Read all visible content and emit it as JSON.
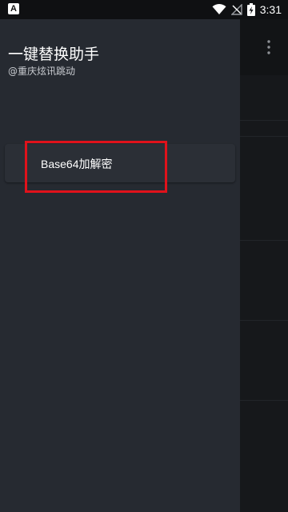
{
  "status_bar": {
    "time": "3:31",
    "app_icon": "A",
    "icons": [
      "wifi-icon",
      "signal-off-icon",
      "battery-charging-icon"
    ]
  },
  "drawer": {
    "title": "一键替换助手",
    "subtitle": "@重庆炫讯跳动",
    "menu_items": [
      {
        "label": "Base64加解密",
        "highlighted": true
      }
    ]
  },
  "background": {
    "toolbar_icon": "more-vertical-icon"
  },
  "colors": {
    "drawer_bg": "#262a31",
    "card_bg": "#2b2f36",
    "highlight": "#e0121b",
    "status_bar_bg": "#0f1012"
  }
}
